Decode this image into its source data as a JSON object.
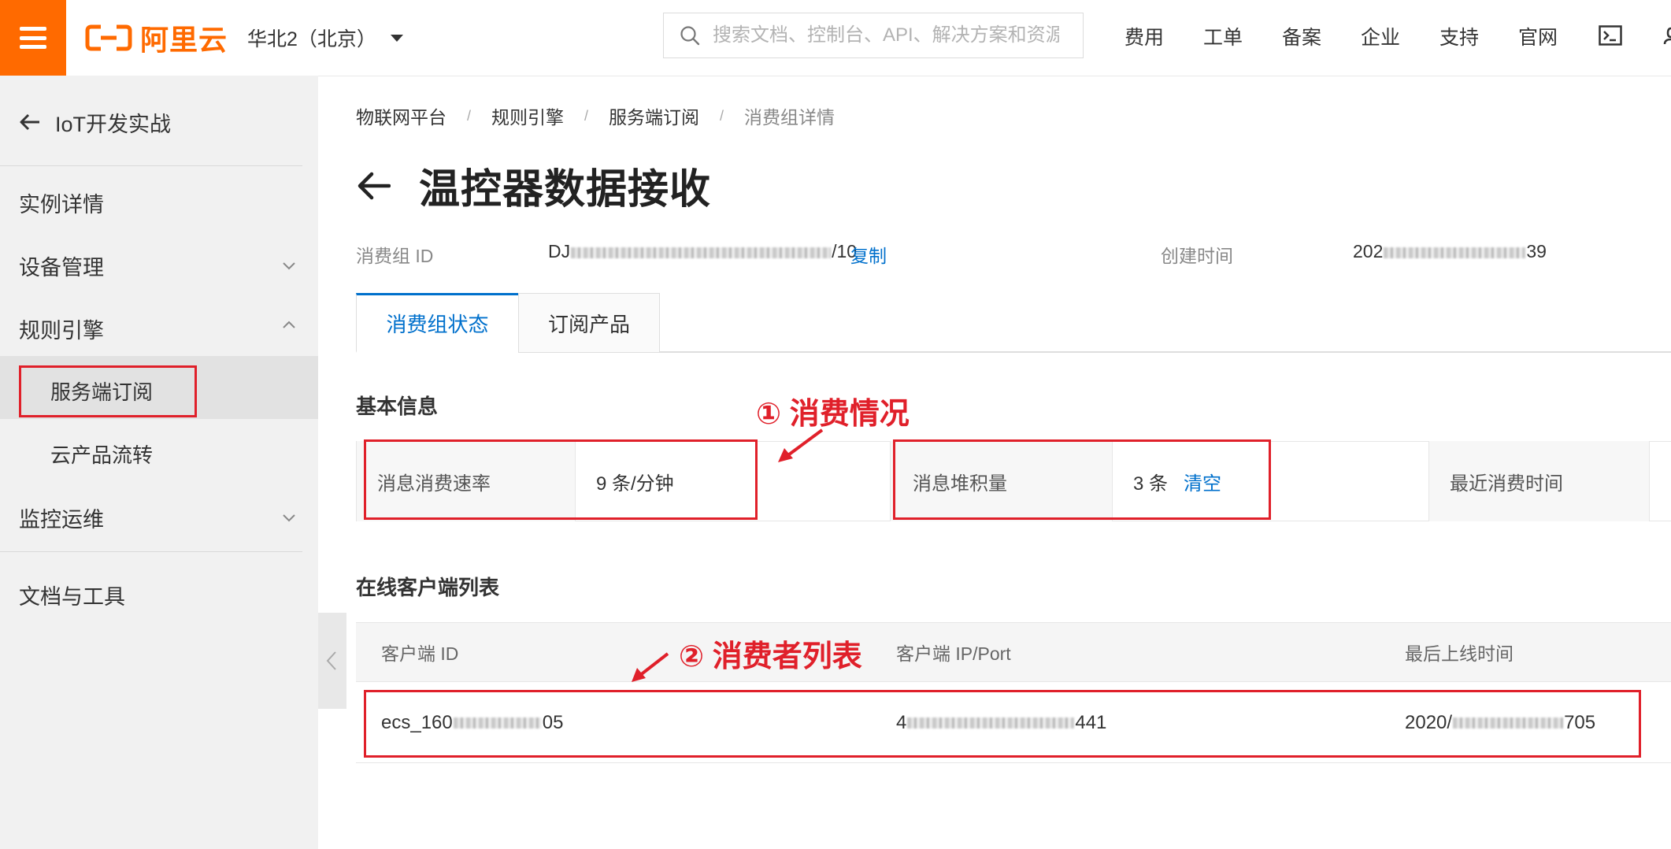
{
  "topbar": {
    "brand": "阿里云",
    "region": "华北2（北京）",
    "search_placeholder": "搜索文档、控制台、API、解决方案和资源",
    "nav": [
      "费用",
      "工单",
      "备案",
      "企业",
      "支持",
      "官网"
    ]
  },
  "sidebar": {
    "back_label": "IoT开发实战",
    "items": [
      {
        "label": "实例详情"
      },
      {
        "label": "设备管理"
      },
      {
        "label": "规则引擎"
      },
      {
        "label": "服务端订阅"
      },
      {
        "label": "云产品流转"
      },
      {
        "label": "监控运维"
      },
      {
        "label": "文档与工具"
      }
    ]
  },
  "breadcrumb": [
    "物联网平台",
    "规则引擎",
    "服务端订阅",
    "消费组详情"
  ],
  "page": {
    "title": "温控器数据接收",
    "consumer_group_id_label": "消费组 ID",
    "consumer_group_id_prefix": "DJ",
    "consumer_group_id_suffix": "/10",
    "copy_label": "复制",
    "created_label": "创建时间",
    "created_prefix": "202",
    "created_suffix": "39"
  },
  "tabs": [
    {
      "label": "消费组状态",
      "active": true
    },
    {
      "label": "订阅产品",
      "active": false
    }
  ],
  "basic_info": {
    "title": "基本信息",
    "rate_label": "消息消费速率",
    "rate_value": "9 条/分钟",
    "backlog_label": "消息堆积量",
    "backlog_value": "3 条",
    "clear_label": "清空",
    "last_consume_label": "最近消费时间"
  },
  "clients": {
    "title": "在线客户端列表",
    "columns": [
      "客户端 ID",
      "客户端 IP/Port",
      "最后上线时间"
    ],
    "row": {
      "id_prefix": "ecs_160",
      "id_suffix": "05",
      "ip_prefix": "4",
      "ip_suffix": "441",
      "time_prefix": "2020/",
      "time_suffix": "705"
    }
  },
  "annotations": {
    "consumption": "① 消费情况",
    "consumers": "② 消费者列表"
  },
  "colors": {
    "brand": "#ff6a00",
    "link": "#0070cc",
    "annotation": "#e0202a"
  }
}
